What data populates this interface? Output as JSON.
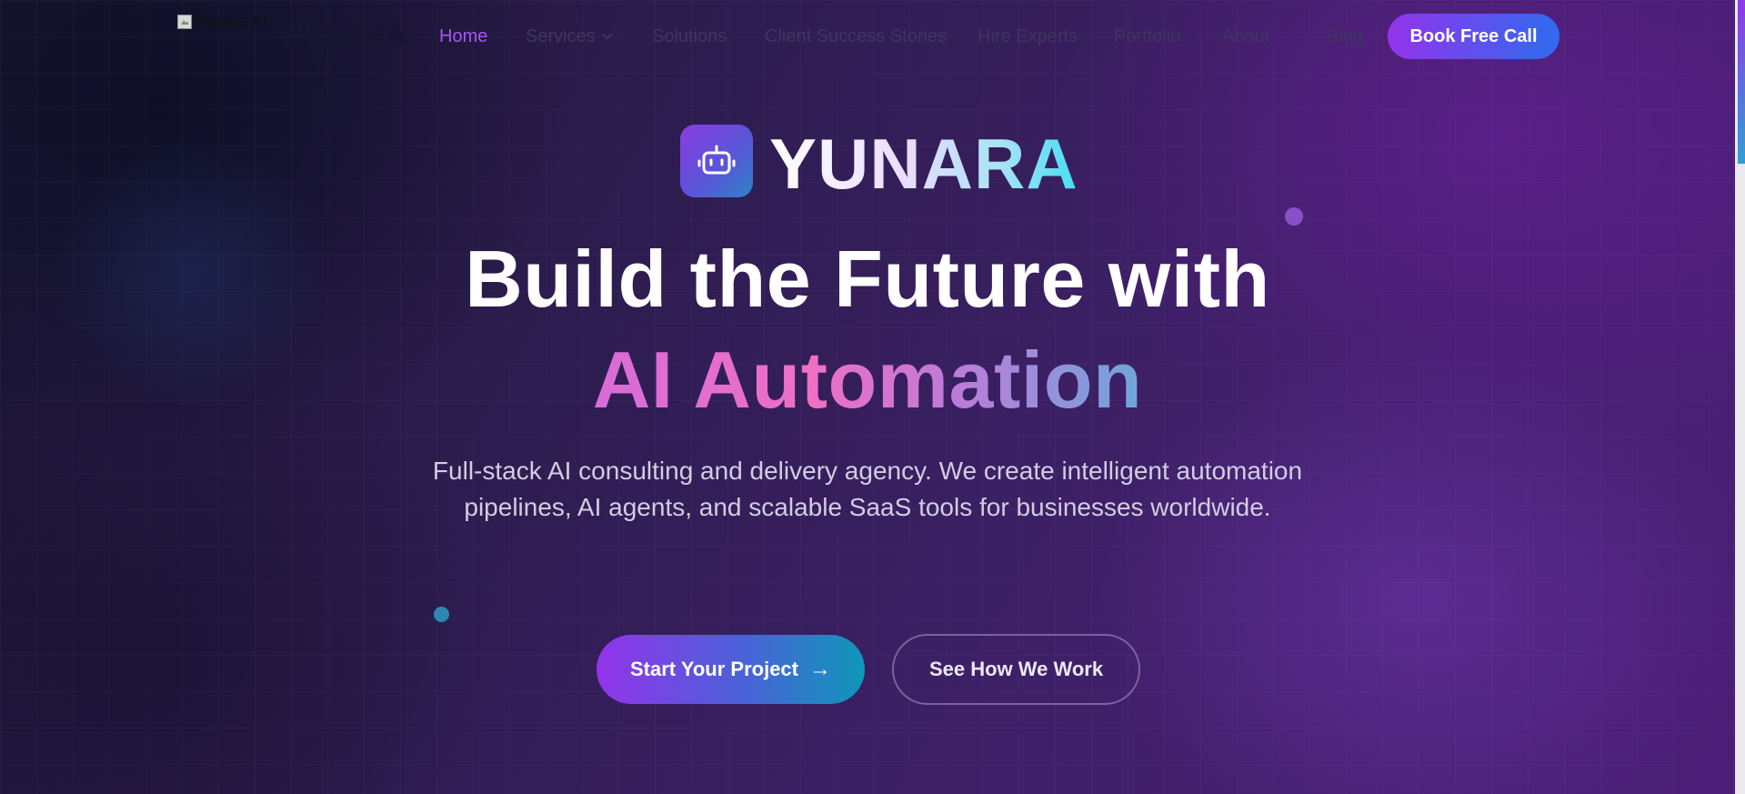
{
  "colors": {
    "accent_purple": "#a855f7",
    "button_gradient_start": "#9333ea",
    "button_gradient_end": "#2f6bf0",
    "cta_gradient_end": "#0f97b8",
    "background": "#2b1c4c"
  },
  "nav": {
    "logo_alt": "Yunara AI",
    "logo_text": "YUNARA",
    "items": [
      {
        "label": "Home",
        "active": true
      },
      {
        "label": "Services",
        "has_dropdown": true
      },
      {
        "label": "Solutions"
      },
      {
        "label": "Client Success Stories"
      },
      {
        "label": "Hire Experts"
      },
      {
        "label": "Portfolio"
      },
      {
        "label": "About"
      },
      {
        "label": "Blog"
      }
    ],
    "cta_label": "Book Free Call"
  },
  "hero": {
    "brand_icon": "robot-icon",
    "brand_word": "YUNARA",
    "headline_line1": "Build the Future with",
    "headline_line2": "AI Automation",
    "subtitle": "Full-stack AI consulting and delivery agency. We create intelligent automation pipelines, AI agents, and scalable SaaS tools for businesses worldwide.",
    "primary_button": {
      "label": "Start Your Project",
      "icon": "arrow-right-icon"
    },
    "secondary_button": {
      "label": "See How We Work"
    }
  }
}
